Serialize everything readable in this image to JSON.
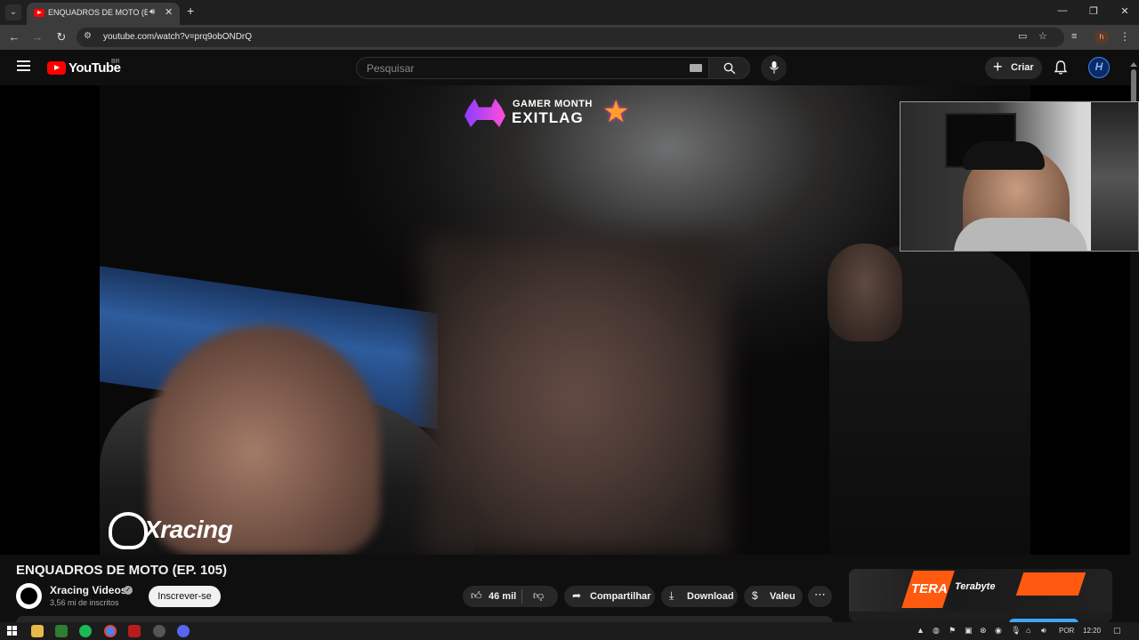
{
  "browser": {
    "tab_title": "ENQUADROS DE MOTO (EP. 105)",
    "url": "youtube.com/watch?v=prq9obONDrQ",
    "profile_initial": "h"
  },
  "youtube": {
    "wordmark": "YouTube",
    "country": "BR",
    "search_placeholder": "Pesquisar",
    "create_label": "Criar",
    "avatar_initial": "H"
  },
  "video": {
    "overlay_small": "GAMER MONTH",
    "overlay_big": "EXITLAG",
    "watermark": "Xracing",
    "title": "ENQUADROS DE MOTO (EP. 105)"
  },
  "channel": {
    "name": "Xracing Videos",
    "subscribers": "3,56 mi de inscritos",
    "subscribe_label": "Inscrever-se"
  },
  "actions": {
    "likes": "46 mil",
    "share_label": "Compartilhar",
    "download_label": "Download",
    "thanks_label": "Valeu"
  },
  "ad": {
    "headline": "TERA",
    "brand": "Terabyte"
  },
  "taskbar": {
    "language": "POR",
    "time": "12:20"
  },
  "colors": {
    "youtube_red": "#ff0000",
    "accent_blue": "#3ea6ff",
    "ad_orange": "#ff5a10"
  }
}
